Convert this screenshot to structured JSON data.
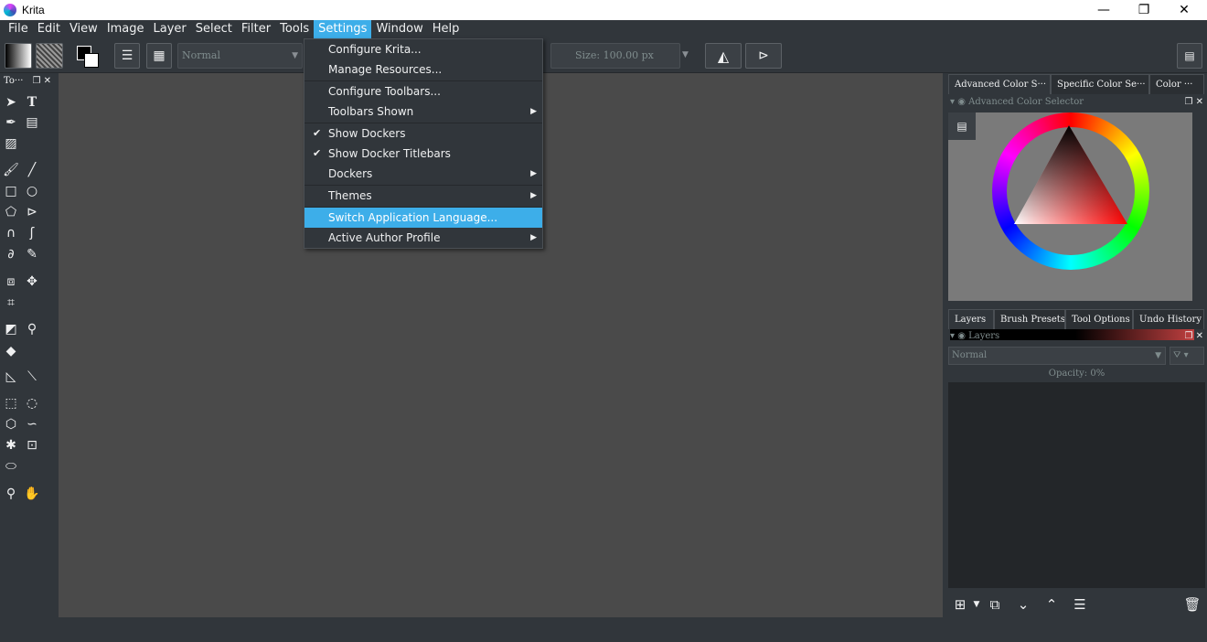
{
  "window": {
    "title": "Krita",
    "minimize_glyph": "—",
    "restore_glyph": "❐",
    "close_glyph": "✕"
  },
  "menubar": [
    "File",
    "Edit",
    "View",
    "Image",
    "Layer",
    "Select",
    "Filter",
    "Tools",
    "Settings",
    "Window",
    "Help"
  ],
  "active_menu": "Settings",
  "toolbar": {
    "blend_mode": "Normal",
    "size_label": "Size:",
    "size_value": "100.00 px"
  },
  "toolbox": {
    "title": "To···"
  },
  "settings_menu": {
    "items": [
      {
        "label": "Configure Krita...",
        "checked": false,
        "submenu": false
      },
      {
        "label": "Manage Resources...",
        "checked": false,
        "submenu": false
      },
      {
        "label": "Configure Toolbars...",
        "checked": false,
        "submenu": false
      },
      {
        "label": "Toolbars Shown",
        "checked": false,
        "submenu": true
      },
      {
        "label": "Show Dockers",
        "checked": true,
        "submenu": false
      },
      {
        "label": "Show Docker Titlebars",
        "checked": true,
        "submenu": false
      },
      {
        "label": "Dockers",
        "checked": false,
        "submenu": true
      },
      {
        "label": "Themes",
        "checked": false,
        "submenu": true
      },
      {
        "label": "Switch Application Language...",
        "checked": false,
        "submenu": false,
        "highlighted": true
      },
      {
        "label": "Active Author Profile",
        "checked": false,
        "submenu": true
      }
    ]
  },
  "dock_top": {
    "tabs": [
      "Advanced Color S···",
      "Specific Color Se···",
      "Color ···"
    ],
    "title": "Advanced Color Selector"
  },
  "dock_bottom": {
    "tabs": [
      "Layers",
      "Brush Presets",
      "Tool Options",
      "Undo History"
    ],
    "title": "Layers",
    "blend_mode": "Normal",
    "opacity": "Opacity:  0%"
  },
  "colors": {
    "accent": "#3daee9",
    "bg": "#31363b",
    "canvas": "#4a4a4a"
  }
}
